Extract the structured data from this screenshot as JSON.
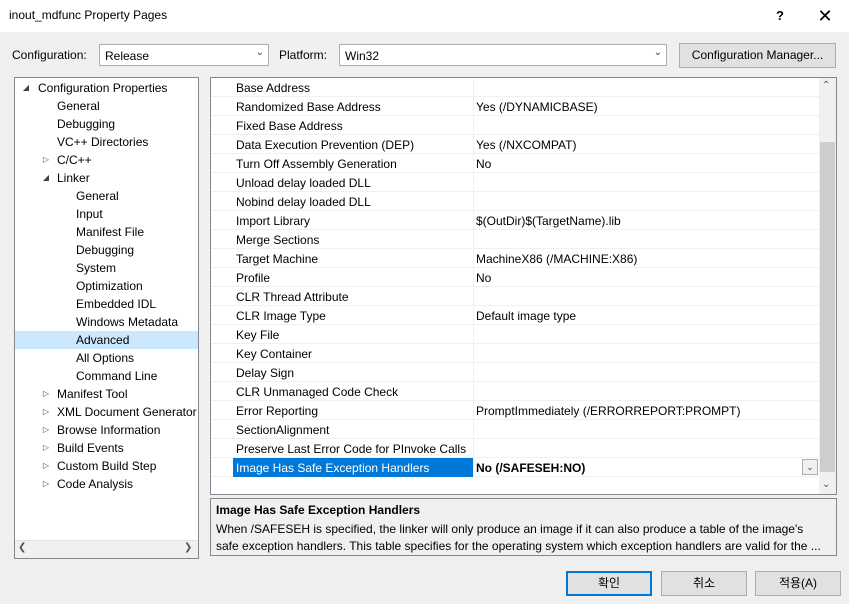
{
  "window": {
    "title": "inout_mdfunc Property Pages",
    "help": "?",
    "close": "✕"
  },
  "toolbar": {
    "config_label": "Configuration:",
    "config_value": "Release",
    "platform_label": "Platform:",
    "platform_value": "Win32",
    "config_manager": "Configuration Manager..."
  },
  "tree": [
    {
      "label": "Configuration Properties",
      "expander": "expanded"
    },
    {
      "label": "General"
    },
    {
      "label": "Debugging"
    },
    {
      "label": "VC++ Directories"
    },
    {
      "label": "C/C++",
      "expander": "collapsed"
    },
    {
      "label": "Linker",
      "expander": "expanded"
    },
    {
      "label": "General"
    },
    {
      "label": "Input"
    },
    {
      "label": "Manifest File"
    },
    {
      "label": "Debugging"
    },
    {
      "label": "System"
    },
    {
      "label": "Optimization"
    },
    {
      "label": "Embedded IDL"
    },
    {
      "label": "Windows Metadata"
    },
    {
      "label": "Advanced",
      "selected": true
    },
    {
      "label": "All Options"
    },
    {
      "label": "Command Line"
    },
    {
      "label": "Manifest Tool",
      "expander": "collapsed"
    },
    {
      "label": "XML Document Generator",
      "expander": "collapsed"
    },
    {
      "label": "Browse Information",
      "expander": "collapsed"
    },
    {
      "label": "Build Events",
      "expander": "collapsed"
    },
    {
      "label": "Custom Build Step",
      "expander": "collapsed"
    },
    {
      "label": "Code Analysis",
      "expander": "collapsed"
    }
  ],
  "properties": [
    {
      "name": "Base Address",
      "value": ""
    },
    {
      "name": "Randomized Base Address",
      "value": "Yes (/DYNAMICBASE)"
    },
    {
      "name": "Fixed Base Address",
      "value": ""
    },
    {
      "name": "Data Execution Prevention (DEP)",
      "value": "Yes (/NXCOMPAT)"
    },
    {
      "name": "Turn Off Assembly Generation",
      "value": "No"
    },
    {
      "name": "Unload delay loaded DLL",
      "value": ""
    },
    {
      "name": "Nobind delay loaded DLL",
      "value": ""
    },
    {
      "name": "Import Library",
      "value": "$(OutDir)$(TargetName).lib"
    },
    {
      "name": "Merge Sections",
      "value": ""
    },
    {
      "name": "Target Machine",
      "value": "MachineX86 (/MACHINE:X86)"
    },
    {
      "name": "Profile",
      "value": "No"
    },
    {
      "name": "CLR Thread Attribute",
      "value": ""
    },
    {
      "name": "CLR Image Type",
      "value": "Default image type"
    },
    {
      "name": "Key File",
      "value": ""
    },
    {
      "name": "Key Container",
      "value": ""
    },
    {
      "name": "Delay Sign",
      "value": ""
    },
    {
      "name": "CLR Unmanaged Code Check",
      "value": ""
    },
    {
      "name": "Error Reporting",
      "value": "PromptImmediately (/ERRORREPORT:PROMPT)"
    },
    {
      "name": "SectionAlignment",
      "value": ""
    },
    {
      "name": "Preserve Last Error Code for PInvoke Calls",
      "value": ""
    },
    {
      "name": "Image Has Safe Exception Handlers",
      "value": "No (/SAFESEH:NO)",
      "selected": true
    }
  ],
  "description": {
    "title": "Image Has Safe Exception Handlers",
    "text": "When /SAFESEH is specified, the linker will only produce an image if it can also produce a table of the image's safe exception handlers. This table specifies for the operating system which exception handlers are valid for the ..."
  },
  "buttons": {
    "ok": "확인",
    "cancel": "취소",
    "apply": "적용(A)"
  },
  "colors": {
    "selection": "#0078d7",
    "tree_selection": "#cce8ff"
  }
}
